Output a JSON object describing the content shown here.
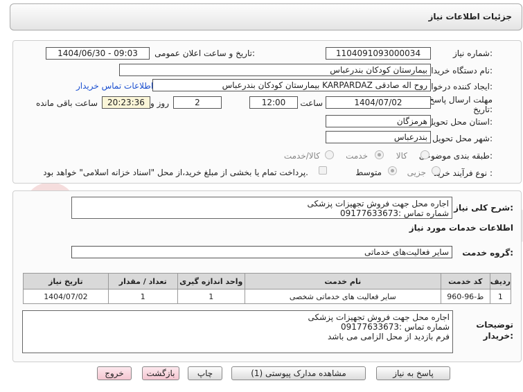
{
  "header": {
    "title": "جزئیات اطلاعات نیاز"
  },
  "form": {
    "need_number_label": "شماره نیاز:",
    "need_number": "1104091093000034",
    "announce_label": "تاریخ و ساعت اعلان عمومی:",
    "announce_value": "1404/06/30 - 09:03",
    "buyer_org_label": "نام دستگاه خریدار:",
    "buyer_org": "بیمارستان کودکان بندرعباس",
    "creator_label": "ایجاد کننده درخواست:",
    "creator": "روح اله صادقی KARPARDAZ بیمارستان کودکان بندرعباس",
    "contact_link": "اطلاعات تماس خریدار",
    "deadline_label_1": "مهلت ارسال پاسخ: تا",
    "deadline_label_2": "تاریخ:",
    "deadline_date": "1404/07/02",
    "time_label": "ساعت",
    "deadline_time": "12:00",
    "days_value": "2",
    "days_label": "روز و",
    "timer_value": "20:23:36",
    "remaining_label": "ساعت باقی مانده",
    "province_label": "استان محل تحویل:",
    "province": "هرمزگان",
    "city_label": "شهر محل تحویل:",
    "city": "بندرعباس",
    "category_label": "طبقه بندی موضوعی:",
    "category_options": [
      "کالا",
      "خدمت",
      "کالا/خدمت"
    ],
    "category_selected": "خدمت",
    "process_label": "نوع فرآیند خرید :",
    "process_options": [
      "جزیی",
      "متوسط"
    ],
    "process_selected": "متوسط",
    "treasury_note": "پرداخت تمام یا بخشی از مبلغ خرید،از محل \"اسناد خزانه اسلامی\" خواهد بود."
  },
  "summary": {
    "label": "شرح کلی نیاز:",
    "line1": "اجاره محل جهت فروش تجهیزات پزشکی",
    "line2": "شماره تماس :09177633673"
  },
  "services": {
    "section_title": "اطلاعات خدمات مورد نیاز",
    "group_label": "گروه خدمت:",
    "group_value": "سایر فعالیت‌های خدماتی",
    "columns": [
      "ردیف",
      "کد خدمت",
      "نام خدمت",
      "واحد اندازه گیری",
      "تعداد / مقدار",
      "تاریخ نیاز"
    ],
    "rows": [
      {
        "row": "1",
        "code": "ط-96-960",
        "name": "سایر فعالیت های خدماتی شخصی",
        "unit": "1",
        "qty": "1",
        "date": "1404/07/02"
      }
    ]
  },
  "buyer_notes": {
    "label_1": "توضیحات",
    "label_2": "خریدار:",
    "line1": "اجاره محل جهت فروش تجهیزات پزشکی",
    "line2": "شماره تماس :09177633673",
    "line3": "فرم بازدید از محل الزامی می باشد"
  },
  "buttons": {
    "reply": "پاسخ به نیاز",
    "attachments": "مشاهده مدارک پیوستی (1)",
    "print": "چاپ",
    "back": "بازگشت",
    "exit": "خروج"
  },
  "watermark": "AriaTender.net"
}
